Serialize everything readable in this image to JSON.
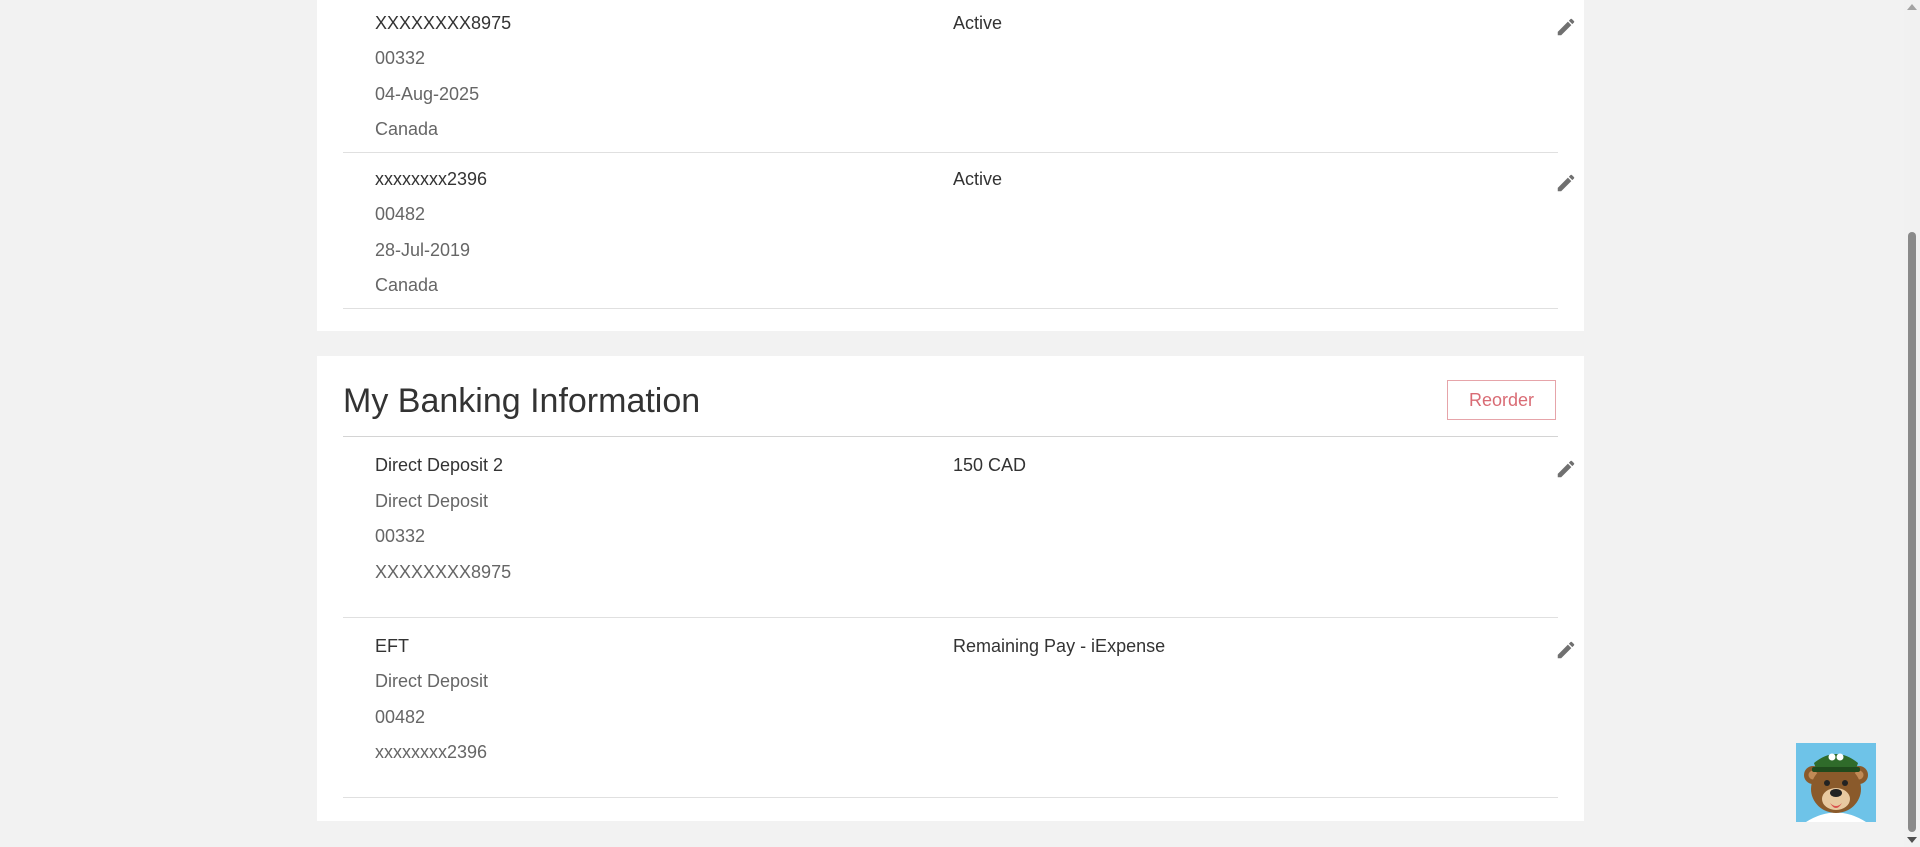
{
  "accounts": {
    "rows": [
      {
        "number": "XXXXXXXX8975",
        "branch": "00332",
        "date": "04-Aug-2025",
        "country": "Canada",
        "status": "Active",
        "edit_icon": "pencil-icon"
      },
      {
        "number": "xxxxxxxx2396",
        "branch": "00482",
        "date": "28-Jul-2019",
        "country": "Canada",
        "status": "Active",
        "edit_icon": "pencil-icon"
      }
    ]
  },
  "banking": {
    "title": "My Banking Information",
    "reorder_label": "Reorder",
    "rows": [
      {
        "name": "Direct Deposit 2",
        "type": "Direct Deposit",
        "branch": "00332",
        "account": "XXXXXXXX8975",
        "amount": "150 CAD",
        "edit_icon": "pencil-icon"
      },
      {
        "name": "EFT",
        "type": "Direct Deposit",
        "branch": "00482",
        "account": "xxxxxxxx2396",
        "amount": "Remaining Pay - iExpense",
        "edit_icon": "pencil-icon"
      }
    ]
  },
  "assistant": {
    "icon": "bear-mascot-icon"
  },
  "colors": {
    "accent": "#d96b74",
    "page_bg": "#f2f2f2",
    "card_bg": "#ffffff"
  }
}
